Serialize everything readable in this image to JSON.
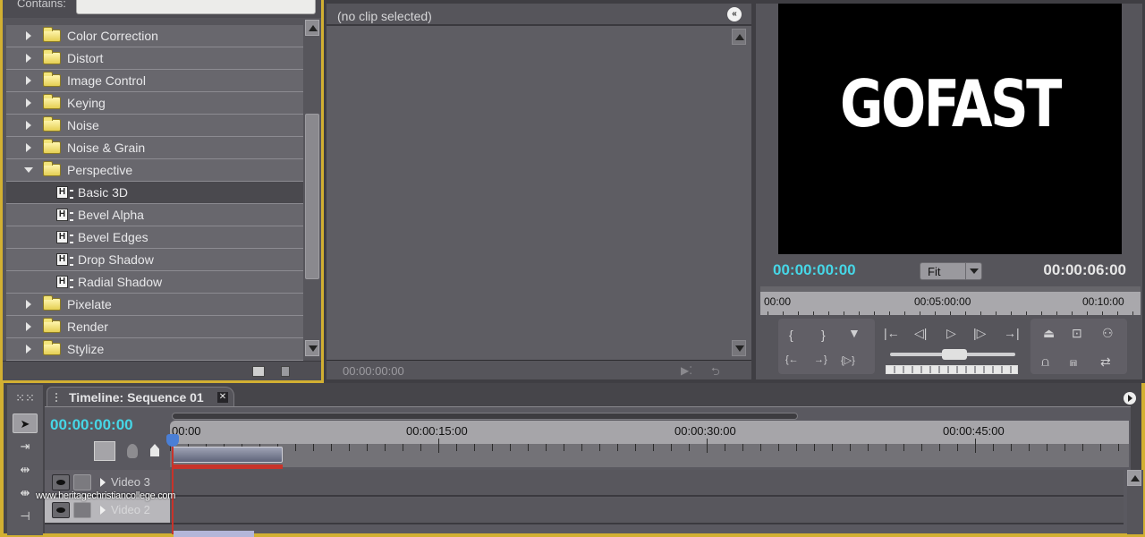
{
  "effects_panel": {
    "contains_label": "Contains:",
    "contains_value": "",
    "items": [
      {
        "type": "folder",
        "label": "Color Correction",
        "expanded": false
      },
      {
        "type": "folder",
        "label": "Distort",
        "expanded": false
      },
      {
        "type": "folder",
        "label": "Image Control",
        "expanded": false
      },
      {
        "type": "folder",
        "label": "Keying",
        "expanded": false
      },
      {
        "type": "folder",
        "label": "Noise",
        "expanded": false
      },
      {
        "type": "folder",
        "label": "Noise & Grain",
        "expanded": false
      },
      {
        "type": "folder",
        "label": "Perspective",
        "expanded": true
      },
      {
        "type": "effect",
        "label": "Basic 3D",
        "selected": true
      },
      {
        "type": "effect",
        "label": "Bevel Alpha"
      },
      {
        "type": "effect",
        "label": "Bevel Edges"
      },
      {
        "type": "effect",
        "label": "Drop Shadow"
      },
      {
        "type": "effect",
        "label": "Radial Shadow"
      },
      {
        "type": "folder",
        "label": "Pixelate",
        "expanded": false
      },
      {
        "type": "folder",
        "label": "Render",
        "expanded": false
      },
      {
        "type": "folder",
        "label": "Stylize",
        "expanded": false
      }
    ],
    "footer_icons": [
      "new-custom-bin-icon",
      "delete-icon"
    ]
  },
  "effect_controls": {
    "header": "(no clip selected)",
    "timecode": "00:00:00:00"
  },
  "program_monitor": {
    "preview_text": "GOFAST",
    "current_time": "00:00:00:00",
    "zoom_select": "Fit",
    "duration": "00:00:06:00",
    "ruler_labels": [
      "00:00",
      "00:05:00:00",
      "00:10:00"
    ]
  },
  "timeline": {
    "tab_title": "Timeline: Sequence 01",
    "current_time": "00:00:00:00",
    "ruler_labels": [
      "00:00",
      "00:00:15:00",
      "00:00:30:00",
      "00:00:45:00"
    ],
    "tracks": [
      {
        "name": "Video 3"
      },
      {
        "name": "Video 2"
      }
    ],
    "tools": [
      "track-select",
      "selection",
      "ripple-edit",
      "rolling-edit",
      "rate-stretch",
      "razor"
    ]
  },
  "watermark": "www.heritagechristiancollege.com",
  "colors": {
    "accent_border": "#d2b032",
    "timecode": "#46d6e6",
    "playhead": "#c8332a"
  }
}
